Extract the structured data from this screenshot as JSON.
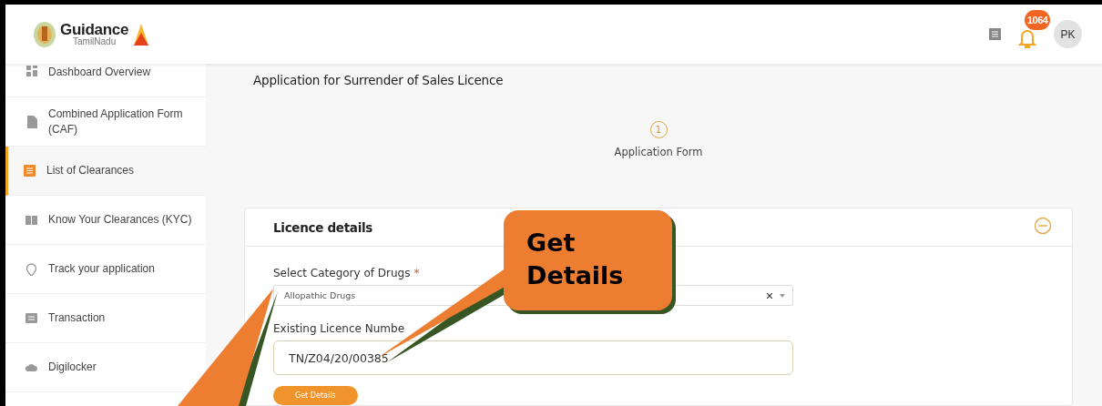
{
  "header": {
    "logo_title": "Guidance",
    "logo_subtitle": "TamilNadu",
    "notification_count": "1064",
    "avatar": "PK"
  },
  "sidebar": {
    "items": [
      {
        "label": "Dashboard Overview",
        "selected": false
      },
      {
        "label": "Combined Application Form (CAF)",
        "selected": false
      },
      {
        "label": "List of Clearances",
        "selected": true
      },
      {
        "label": "Know Your Clearances (KYC)",
        "selected": false
      },
      {
        "label": "Track your application",
        "selected": false
      },
      {
        "label": "Transaction",
        "selected": false
      },
      {
        "label": "Digilocker",
        "selected": false
      }
    ]
  },
  "page": {
    "title": "Application for Surrender of Sales Licence",
    "steps": [
      {
        "number": "1",
        "label": "Application Form"
      }
    ]
  },
  "card": {
    "title": "Licence details",
    "expanded": true,
    "fields": [
      {
        "kind": "select",
        "label": "Select Category of Drugs",
        "required_mark": "*",
        "value": "Allopathic Drugs"
      },
      {
        "kind": "text",
        "label": "Existing Licence Numbe",
        "value": "TN/Z04/20/00385"
      }
    ],
    "button": "Get Details"
  },
  "callout": {
    "text": "Get Details"
  }
}
